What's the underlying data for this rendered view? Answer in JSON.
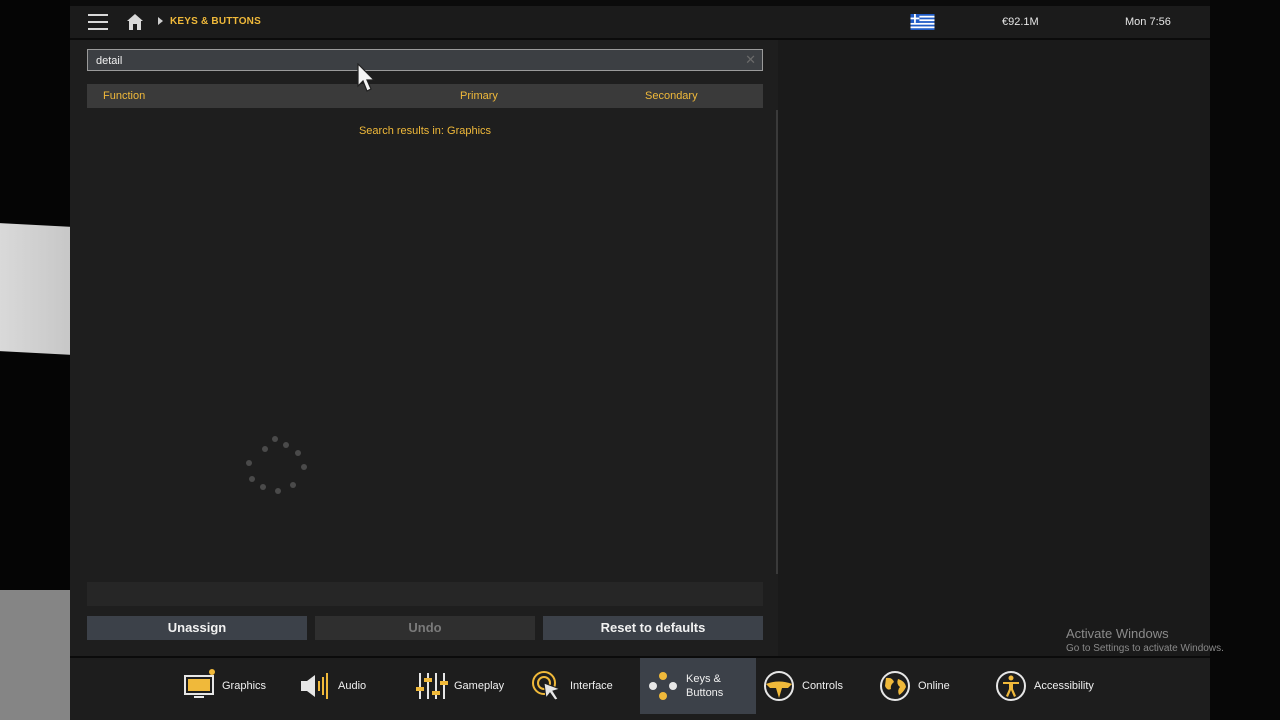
{
  "topbar": {
    "breadcrumb": "KEYS & BUTTONS",
    "money": "€92.1M",
    "clock": "Mon 7:56"
  },
  "search": {
    "value": "detail"
  },
  "table": {
    "columns": [
      "Function",
      "Primary",
      "Secondary"
    ],
    "results_text": "Search results in: Graphics"
  },
  "buttons": {
    "unassign": "Unassign",
    "undo": "Undo",
    "reset": "Reset to defaults"
  },
  "tabs": [
    {
      "label": "Graphics",
      "icon": "monitor-icon"
    },
    {
      "label": "Audio",
      "icon": "speaker-icon"
    },
    {
      "label": "Gameplay",
      "icon": "sliders-icon"
    },
    {
      "label": "Interface",
      "icon": "pointer-icon"
    },
    {
      "label": "Keys & Buttons",
      "icon": "keys-icon",
      "active": true
    },
    {
      "label": "Controls",
      "icon": "steering-wheel-icon"
    },
    {
      "label": "Online",
      "icon": "globe-icon"
    },
    {
      "label": "Accessibility",
      "icon": "accessibility-icon"
    }
  ],
  "watermark": {
    "title": "Activate Windows",
    "subtitle": "Go to Settings to activate Windows."
  },
  "colors": {
    "accent": "#f0b93a",
    "active_tab": "#3c4149"
  }
}
